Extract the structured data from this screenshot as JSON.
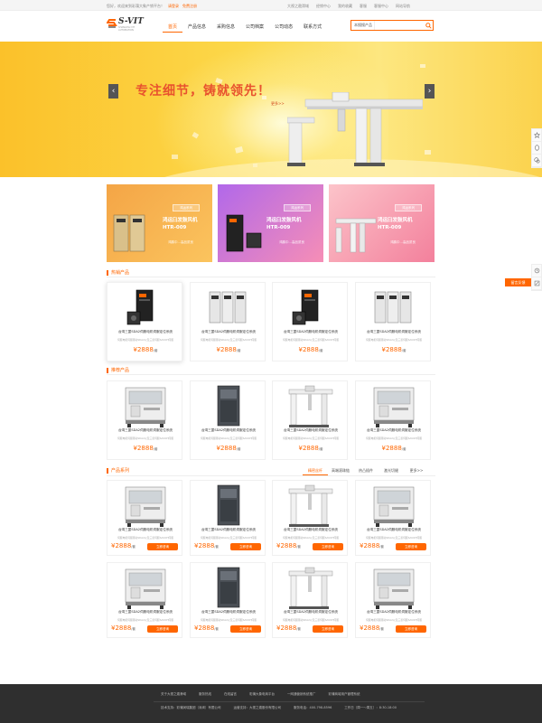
{
  "topbar": {
    "welcome": "您好，欢迎来到彩蒲大象产销平台！",
    "login": "请登录",
    "register": "免费注册",
    "links": [
      "大视之遨滑域",
      "经销中心",
      "我的收藏",
      "客服",
      "客服中心",
      "网站导航"
    ]
  },
  "header": {
    "logo_text": "S-VIT",
    "logo_sub": "SHANGHAI VIT AUTOMATION",
    "nav": [
      "首页",
      "产品信息",
      "采购信息",
      "公司档案",
      "公司动态",
      "联系方式"
    ],
    "search_select": "本搜搜产品",
    "search_placeholder": ""
  },
  "banner": {
    "slogan": "专注细节，铸就领先！",
    "more": "更多>>",
    "prev": "‹",
    "next": "›"
  },
  "promos": [
    {
      "tag": "鸿运系列",
      "title": "鸿运臼发鼓风机 HTR-009",
      "sub": "鸿鹏中…高品质良",
      "color1": "#f5a94a",
      "color2": "#fbc05a"
    },
    {
      "tag": "鸿运系列",
      "title": "鸿运臼发鼓风机 HTR-009",
      "sub": "鸿鹏中…高品质良",
      "color1": "#b36be8",
      "color2": "#f58cb8"
    },
    {
      "tag": "鸿运系列",
      "title": "鸿运臼发鼓风机 HTR-009",
      "sub": "鸿鹏中…高品质良",
      "color1": "#fbb6c2",
      "color2": "#f37f9b"
    }
  ],
  "sections": {
    "hot": "热销产品",
    "recommend": "推荐产品",
    "series": "产品系列"
  },
  "product_name": "台湾三菱SDA2伺服电机伺服定位系统",
  "product_desc": "伺服电机伺服驱动SDA2以及三菱伺服SAVOH伺服",
  "price": "¥2888",
  "price_unit": "/套",
  "consult_btn": "立即咨询",
  "series_tabs": [
    "精密丝杆",
    "高端滚珠链",
    "热凸插件",
    "激光切缝",
    "更多>>"
  ],
  "side": {
    "feedback": "留言反馈"
  },
  "footer": {
    "row1": [
      "关于大视之遨滑域",
      "服务热线",
      "在线留言",
      "彩蒲大象电商平台",
      "一网通营销系统推广",
      "彩蒲商城用户管理系统"
    ],
    "row2": [
      "技术支持：彩蒲润瑞集团（深圳）有限公司",
      "运营支持：大视之遨股份有限公司",
      "服务电话：400-798-8596",
      "工作日（周一～周五）：8:30-18:00"
    ]
  },
  "colors": {
    "accent": "#ff6600",
    "banner": "#fbc12a",
    "footer": "#2f2f2f"
  }
}
